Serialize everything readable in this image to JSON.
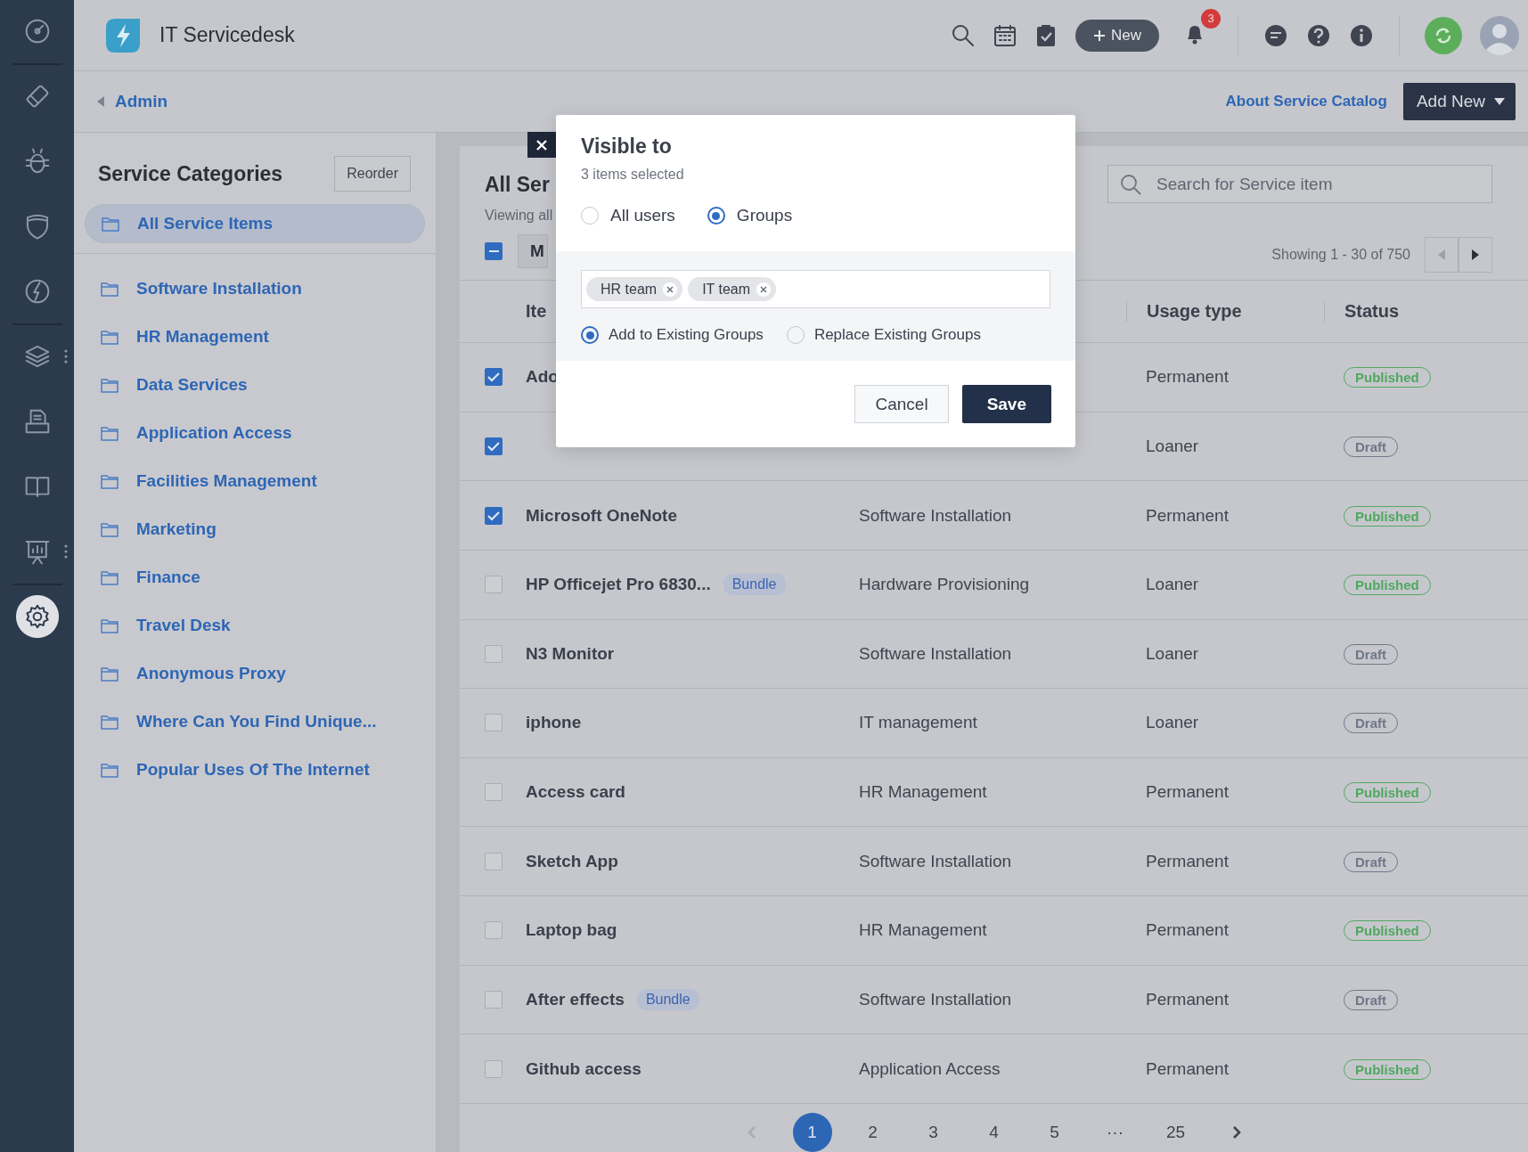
{
  "nav": {
    "groups": [
      [
        {
          "kind": "dashboard",
          "selected": false,
          "has_menu": false
        }
      ],
      [
        {
          "kind": "tickets",
          "selected": false,
          "has_menu": false
        },
        {
          "kind": "problems",
          "selected": false,
          "has_menu": false
        },
        {
          "kind": "changes",
          "selected": false,
          "has_menu": false
        },
        {
          "kind": "releases",
          "selected": false,
          "has_menu": false
        }
      ],
      [
        {
          "kind": "assets",
          "selected": false,
          "has_menu": true
        },
        {
          "kind": "inbox",
          "selected": false,
          "has_menu": false
        },
        {
          "kind": "solutions",
          "selected": false,
          "has_menu": false
        },
        {
          "kind": "reports",
          "selected": false,
          "has_menu": true
        }
      ],
      [
        {
          "kind": "admin",
          "selected": true,
          "has_menu": false
        }
      ]
    ]
  },
  "topbar": {
    "app_title": "IT Servicedesk",
    "new_button": "New",
    "notification_count": "3"
  },
  "subbar": {
    "back_link": "Admin",
    "catalog_link": "About Service Catalog",
    "add_button": "Add New"
  },
  "categories": {
    "title": "Service Categories",
    "reorder_button": "Reorder",
    "all_item": {
      "label": "All Service Items",
      "selected": true
    },
    "items": [
      {
        "label": "Software Installation",
        "selected": false
      },
      {
        "label": "HR Management",
        "selected": false
      },
      {
        "label": "Data Services",
        "selected": false
      },
      {
        "label": "Application Access",
        "selected": false
      },
      {
        "label": "Facilities Management",
        "selected": false
      },
      {
        "label": "Marketing",
        "selected": false
      },
      {
        "label": "Finance",
        "selected": false
      },
      {
        "label": "Travel Desk",
        "selected": false
      },
      {
        "label": "Anonymous Proxy",
        "selected": false
      },
      {
        "label": "Where Can You Find Unique...",
        "selected": false
      },
      {
        "label": "Popular Uses Of The Internet",
        "selected": false
      }
    ]
  },
  "content": {
    "title": "All Ser",
    "subtitle": "Viewing all",
    "select_all_indeterminate": true,
    "bulk_action": "M",
    "search": {
      "placeholder": "Search for Service item"
    },
    "range": "Showing 1 - 30 of 750",
    "table": {
      "columns": [
        "Ite",
        "Usage type",
        "Status"
      ],
      "rows": [
        {
          "checked": true,
          "item": "Ado",
          "usage": "Permanent",
          "status": {
            "label": "Published",
            "color": "#4fa860"
          }
        },
        {
          "checked": true,
          "usage": "Loaner",
          "status": {
            "label": "Draft",
            "color": "#6f7788"
          }
        },
        {
          "checked": true,
          "item": "Microsoft OneNote",
          "category": "Software Installation",
          "usage": "Permanent",
          "status": {
            "label": "Published",
            "color": "#4fa860"
          }
        },
        {
          "checked": false,
          "item": "HP Officejet Pro 6830...",
          "bundle": "Bundle",
          "category": "Hardware Provisioning",
          "usage": "Loaner",
          "status": {
            "label": "Published",
            "color": "#4fa860"
          }
        },
        {
          "checked": false,
          "item": "N3 Monitor",
          "category": "Software Installation",
          "usage": "Loaner",
          "status": {
            "label": "Draft",
            "color": "#6f7788"
          }
        },
        {
          "checked": false,
          "item": "iphone",
          "category": "IT management",
          "usage": "Loaner",
          "status": {
            "label": "Draft",
            "color": "#6f7788"
          }
        },
        {
          "checked": false,
          "item": "Access card",
          "category": "HR Management",
          "usage": "Permanent",
          "status": {
            "label": "Published",
            "color": "#4fa860"
          }
        },
        {
          "checked": false,
          "item": "Sketch App",
          "category": "Software Installation",
          "usage": "Permanent",
          "status": {
            "label": "Draft",
            "color": "#6f7788"
          }
        },
        {
          "checked": false,
          "item": "Laptop bag",
          "category": "HR Management",
          "usage": "Permanent",
          "status": {
            "label": "Published",
            "color": "#4fa860"
          }
        },
        {
          "checked": false,
          "item": "After effects",
          "bundle": "Bundle",
          "category": "Software Installation",
          "usage": "Permanent",
          "status": {
            "label": "Draft",
            "color": "#6f7788"
          }
        },
        {
          "checked": false,
          "item": "Github access",
          "category": "Application Access",
          "usage": "Permanent",
          "status": {
            "label": "Published",
            "color": "#4fa860"
          }
        }
      ]
    },
    "pagination": {
      "prev_disabled": true,
      "pages": [
        {
          "label": "1",
          "selected": true
        },
        {
          "label": "2",
          "selected": false
        },
        {
          "label": "3",
          "selected": false
        },
        {
          "label": "4",
          "selected": false
        },
        {
          "label": "5",
          "selected": false
        },
        {
          "label": "···",
          "selected": false
        },
        {
          "label": "25",
          "selected": false
        }
      ]
    }
  },
  "modal": {
    "title": "Visible to",
    "subtitle": "3 items selected",
    "audience": [
      {
        "label": "All users",
        "selected": false
      },
      {
        "label": "Groups",
        "selected": true
      }
    ],
    "groups": [
      "HR team",
      "IT team"
    ],
    "mode": [
      {
        "label": "Add to Existing Groups",
        "selected": true
      },
      {
        "label": "Replace Existing Groups",
        "selected": false
      }
    ],
    "cancel_button": "Cancel",
    "save_button": "Save"
  }
}
